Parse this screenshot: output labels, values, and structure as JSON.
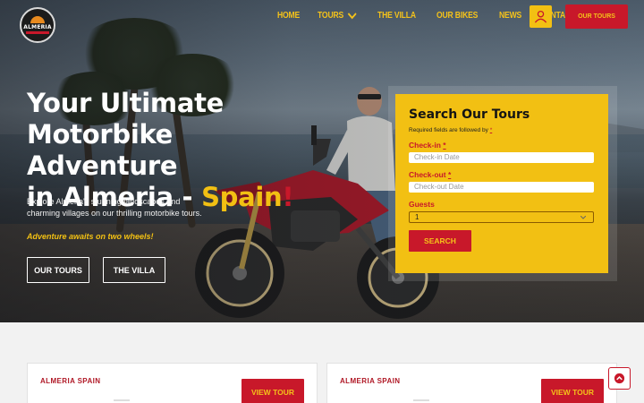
{
  "brand": {
    "logo_text": "ALMERIA",
    "accent_yellow": "#f2c013",
    "accent_red": "#c8182a"
  },
  "nav": {
    "items": [
      {
        "label": "HOME"
      },
      {
        "label": "TOURS",
        "icon": "chevron-down-icon"
      },
      {
        "label": "THE VILLA"
      },
      {
        "label": "OUR BIKES"
      },
      {
        "label": "NEWS"
      },
      {
        "label": "CONTACT US"
      }
    ],
    "user_icon": "user-icon",
    "cta_label": "OUR TOURS"
  },
  "hero": {
    "title_line1": "Your Ultimate",
    "title_line2": "Motorbike Adventure",
    "title_line3_prefix": "in Almeria - ",
    "title_highlight": "Spain",
    "title_bang": "!",
    "description": "Explore Almeria's stunning landscapes and charming villages on our thrilling motorbike tours.",
    "tagline": "Adventure awaits on two wheels!",
    "button_tours": "OUR TOURS",
    "button_villa": "THE VILLA"
  },
  "search": {
    "title": "Search Our Tours",
    "required_note": "Required fields are followed by",
    "required_star": "*",
    "checkin_label": "Check-in",
    "checkin_placeholder": "Check-in Date",
    "checkout_label": "Check-out",
    "checkout_placeholder": "Check-out Date",
    "guests_label": "Guests",
    "guests_value": "1",
    "submit_label": "SEARCH"
  },
  "cards": [
    {
      "label": "ALMERIA SPAIN",
      "button": "VIEW TOUR"
    },
    {
      "label": "ALMERIA SPAIN",
      "button": "VIEW TOUR"
    }
  ],
  "back_to_top_icon": "arrow-up-icon"
}
